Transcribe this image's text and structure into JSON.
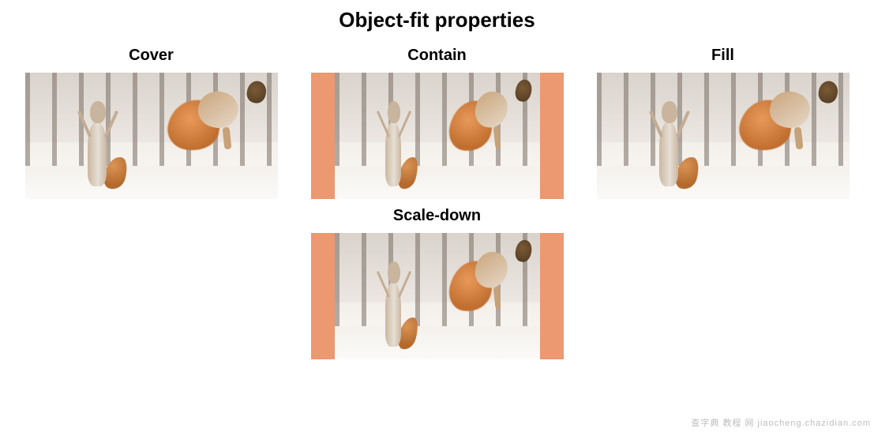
{
  "title": "Object-fit properties",
  "examples": {
    "cover": {
      "label": "Cover"
    },
    "contain": {
      "label": "Contain"
    },
    "fill": {
      "label": "Fill"
    },
    "scale_down": {
      "label": "Scale-down"
    }
  },
  "watermark": "查字典 教程 网  jiaocheng.chazidian.com",
  "image_subject": "two squirrels playing in snow with a pinecone"
}
